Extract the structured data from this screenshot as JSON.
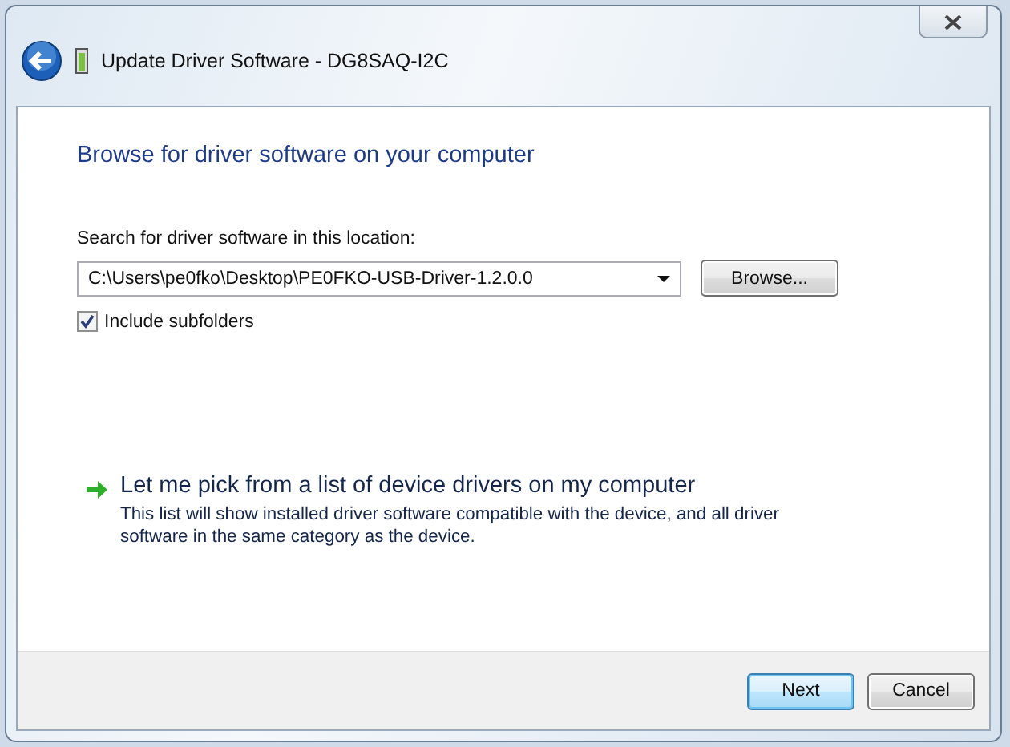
{
  "window": {
    "title": "Update Driver Software - DG8SAQ-I2C"
  },
  "heading": "Browse for driver software on your computer",
  "location": {
    "label": "Search for driver software in this location:",
    "value": "C:\\Users\\pe0fko\\Desktop\\PE0FKO-USB-Driver-1.2.0.0",
    "browse": "Browse..."
  },
  "include_subfolders": {
    "label": "Include subfolders",
    "checked": true
  },
  "pick_option": {
    "title": "Let me pick from a list of device drivers on my computer",
    "description": "This list will show installed driver software compatible with the device, and all driver software in the same category as the device."
  },
  "buttons": [
    {
      "label": "Next",
      "kind": "default"
    },
    {
      "label": "Cancel",
      "kind": "normal"
    }
  ]
}
